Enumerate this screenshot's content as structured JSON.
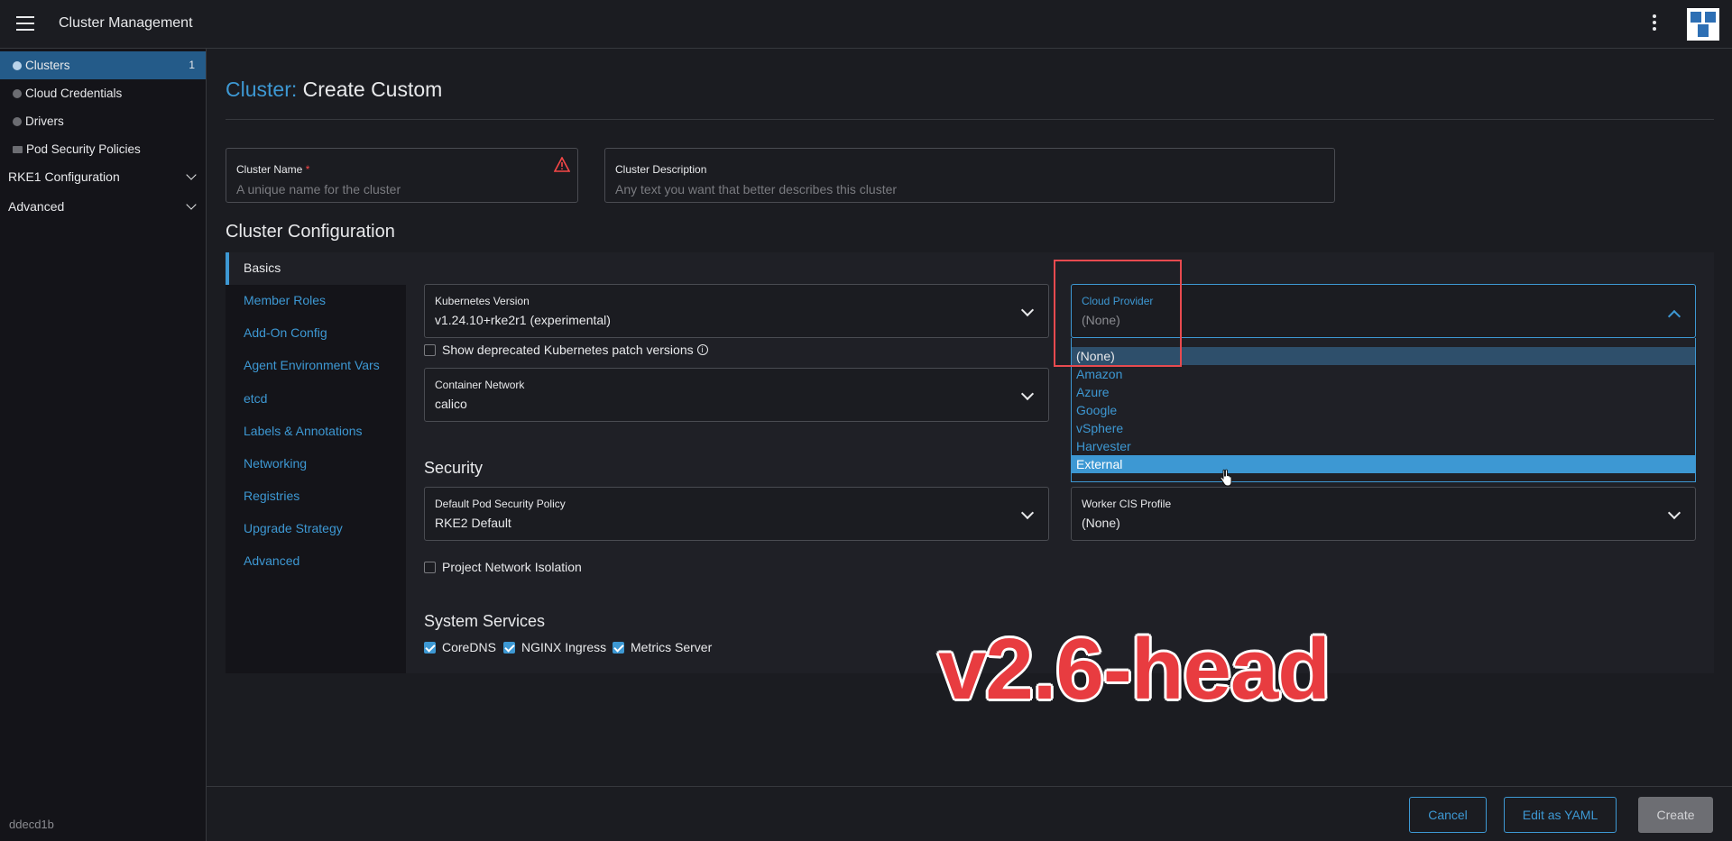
{
  "header": {
    "title": "Cluster Management"
  },
  "sidebar": {
    "items": [
      {
        "label": "Clusters",
        "badge": "1"
      },
      {
        "label": "Cloud Credentials"
      },
      {
        "label": "Drivers"
      },
      {
        "label": "Pod Security Policies"
      }
    ],
    "groups": [
      {
        "label": "RKE1 Configuration"
      },
      {
        "label": "Advanced"
      }
    ],
    "version": "ddecd1b"
  },
  "page": {
    "title_prefix": "Cluster:",
    "title": "Create Custom"
  },
  "form": {
    "cluster_name": {
      "label": "Cluster Name",
      "required_mark": "*",
      "placeholder": "A unique name for the cluster"
    },
    "cluster_description": {
      "label": "Cluster Description",
      "placeholder": "Any text you want that better describes this cluster"
    }
  },
  "config": {
    "title": "Cluster Configuration",
    "nav": [
      "Basics",
      "Member Roles",
      "Add-On Config",
      "Agent Environment Vars",
      "etcd",
      "Labels & Annotations",
      "Networking",
      "Registries",
      "Upgrade Strategy",
      "Advanced"
    ],
    "kubernetes_version": {
      "label": "Kubernetes Version",
      "value": "v1.24.10+rke2r1 (experimental)"
    },
    "show_deprecated": {
      "label": "Show deprecated Kubernetes patch versions"
    },
    "container_network": {
      "label": "Container Network",
      "value": "calico"
    },
    "cloud_provider": {
      "label": "Cloud Provider",
      "value": "(None)",
      "options": [
        "(None)",
        "Amazon",
        "Azure",
        "Google",
        "vSphere",
        "Harvester",
        "External"
      ]
    },
    "security": {
      "title": "Security",
      "pod_security_policy": {
        "label": "Default Pod Security Policy",
        "value": "RKE2 Default"
      },
      "worker_cis": {
        "label": "Worker CIS Profile",
        "value": "(None)"
      },
      "project_network_isolation": {
        "label": "Project Network Isolation"
      }
    },
    "system_services": {
      "title": "System Services",
      "items": [
        "CoreDNS",
        "NGINX Ingress",
        "Metrics Server"
      ]
    }
  },
  "watermark": "v2.6-head",
  "footer": {
    "cancel": "Cancel",
    "edit_yaml": "Edit as YAML",
    "create": "Create"
  },
  "colors": {
    "accent": "#3d98d3",
    "background": "#1b1c21",
    "sidebar_active": "#245b89",
    "highlight": "#e84a4f"
  }
}
